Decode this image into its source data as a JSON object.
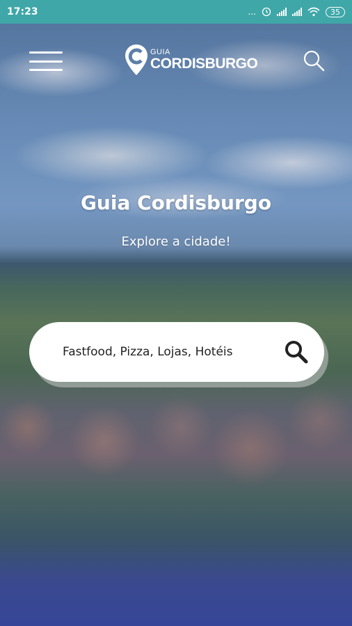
{
  "status_bar": {
    "time": "17:23",
    "dots": "...",
    "battery": "35"
  },
  "header": {
    "logo_small": "GUIA",
    "logo_big": "CORDISBURGO"
  },
  "hero": {
    "title": "Guia Cordisburgo",
    "subtitle": "Explore a cidade!"
  },
  "search": {
    "placeholder": "Fastfood, Pizza, Lojas, Hotéis",
    "value": ""
  },
  "colors": {
    "status_bar": "#3fa7a8",
    "search_icon": "#222222"
  }
}
